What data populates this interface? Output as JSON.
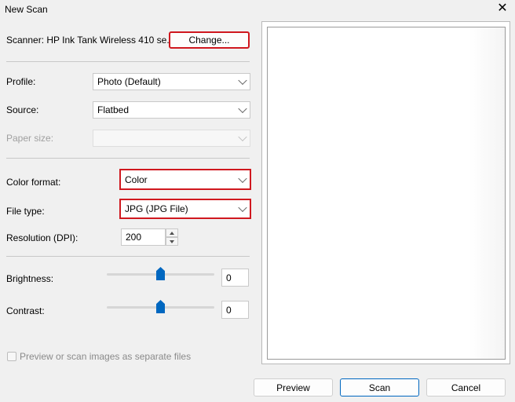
{
  "window": {
    "title": "New Scan",
    "close_glyph": "✕"
  },
  "scanner": {
    "label": "Scanner: HP Ink Tank Wireless 410 se...",
    "change_label": "Change..."
  },
  "profile": {
    "label": "Profile:",
    "value": "Photo (Default)"
  },
  "source": {
    "label": "Source:",
    "value": "Flatbed"
  },
  "paper_size": {
    "label": "Paper size:",
    "value": ""
  },
  "color_format": {
    "label": "Color format:",
    "value": "Color"
  },
  "file_type": {
    "label": "File type:",
    "value": "JPG (JPG File)"
  },
  "resolution": {
    "label": "Resolution (DPI):",
    "value": "200"
  },
  "brightness": {
    "label": "Brightness:",
    "value": "0",
    "level": 0.5
  },
  "contrast": {
    "label": "Contrast:",
    "value": "0",
    "level": 0.5
  },
  "separate_files": {
    "label": "Preview or scan images as separate files",
    "checked": false
  },
  "buttons": {
    "preview": "Preview",
    "scan": "Scan",
    "cancel": "Cancel"
  },
  "colors": {
    "accent": "#0067c0",
    "highlight": "#d0181f"
  }
}
